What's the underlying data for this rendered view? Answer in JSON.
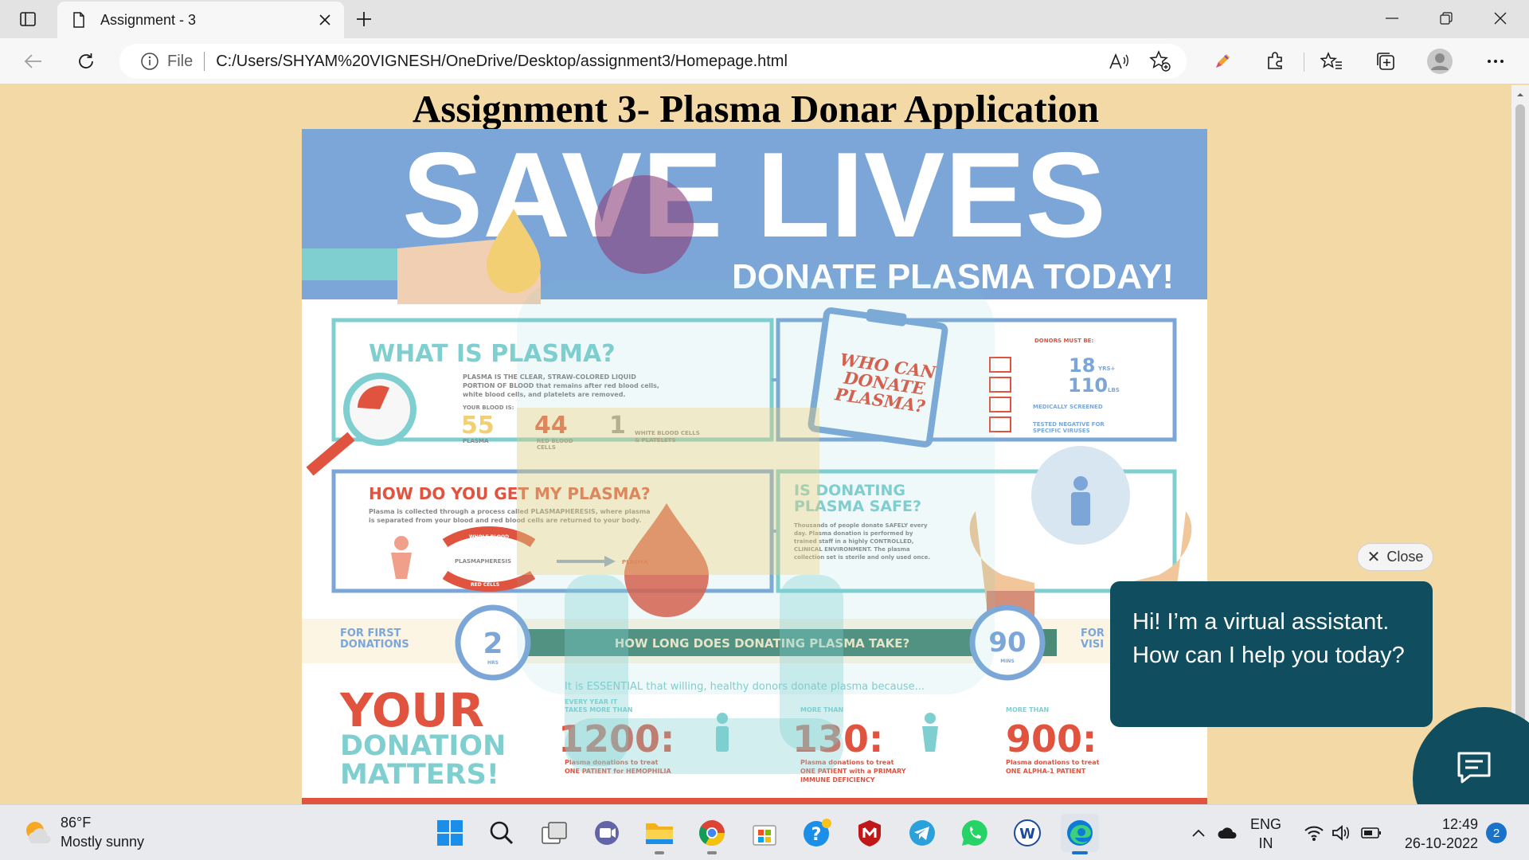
{
  "browser": {
    "tab_title": "Assignment - 3",
    "address_scheme": "File",
    "address_url": "C:/Users/SHYAM%20VIGNESH/OneDrive/Desktop/assignment3/Homepage.html"
  },
  "page": {
    "title": "Assignment 3- Plasma Donar Application"
  },
  "poster": {
    "headline": "SAVE LIVES",
    "subheadline": "DONATE PLASMA TODAY!",
    "what_title": "WHAT IS PLASMA?",
    "what_body_1": "PLASMA IS THE CLEAR, STRAW-COLORED LIQUID",
    "what_body_2": "PORTION OF BLOOD that remains after red blood cells,",
    "what_body_3": "white blood cells, and platelets are removed.",
    "your_blood": "YOUR BLOOD IS:",
    "stat_plasma_value": "55",
    "stat_plasma_label": "PLASMA",
    "stat_rbc_value": "44",
    "stat_rbc_label_1": "RED BLOOD",
    "stat_rbc_label_2": "CELLS",
    "stat_wbc_value": "1",
    "stat_wbc_label_1": "WHITE BLOOD CELLS",
    "stat_wbc_label_2": "& PLATELETS",
    "who_title_1": "WHO CAN",
    "who_title_2": "DONATE",
    "who_title_3": "PLASMA?",
    "donors_must_be": "DONORS MUST BE:",
    "req_age": "18",
    "req_age_unit": "YRS+",
    "req_weight": "110",
    "req_weight_unit": "LBS",
    "req_screened": "MEDICALLY SCREENED",
    "req_tested_1": "TESTED NEGATIVE FOR",
    "req_tested_2": "SPECIFIC VIRUSES",
    "how_title": "HOW DO YOU GET MY PLASMA?",
    "how_body_1": "Plasma is collected through a process called PLASMAPHERESIS, where plasma",
    "how_body_2": "is separated from your blood and red blood cells are returned to your body.",
    "how_blood_label": "WHOLE BLOOD",
    "how_process_label": "PLASMAPHERESIS",
    "how_cells_label": "RED CELLS",
    "how_plasma_label": "PLASMA",
    "safe_title_1": "IS DONATING",
    "safe_title_2": "PLASMA SAFE?",
    "safe_body_1": "Thousands of people donate SAFELY every",
    "safe_body_2": "day. Plasma donation is performed by",
    "safe_body_3": "trained staff in a highly CONTROLLED,",
    "safe_body_4": "CLINICAL ENVIRONMENT. The plasma",
    "safe_body_5": "collection set is sterile and only used once.",
    "time_first_1": "FOR FIRST",
    "time_first_2": "DONATIONS",
    "time_first_value": "2",
    "time_first_unit": "HRS",
    "time_question": "HOW LONG DOES DONATING PLASMA TAKE?",
    "time_repeat_value": "90",
    "time_repeat_unit": "MINS",
    "time_repeat_1": "FOR",
    "time_repeat_2": "VISI",
    "matters_1": "YOUR",
    "matters_2": "DONATION",
    "matters_3": "MATTERS!",
    "essential": "It is ESSENTIAL that willing, healthy donors donate plasma because...",
    "fact1_pre_1": "EVERY YEAR IT",
    "fact1_pre_2": "TAKES MORE THAN",
    "fact1_value": "1200:",
    "fact1_post_1": "Plasma donations to treat",
    "fact1_post_2": "ONE PATIENT for HEMOPHILIA",
    "fact2_pre": "MORE THAN",
    "fact2_value": "130:",
    "fact2_post_1": "Plasma donations to treat",
    "fact2_post_2": "ONE PATIENT with a PRIMARY",
    "fact2_post_3": "IMMUNE DEFICIENCY",
    "fact3_pre": "MORE THAN",
    "fact3_value": "900:",
    "fact3_post_1": "Plasma donations to treat",
    "fact3_post_2": "ONE ALPHA-1 PATIENT"
  },
  "chatbot": {
    "close_label": "Close",
    "message": "Hi! I’m a virtual assistant. How can I help you today?"
  },
  "taskbar": {
    "weather_temp": "86°F",
    "weather_desc": "Mostly sunny",
    "lang_1": "ENG",
    "lang_2": "IN",
    "time": "12:49",
    "date": "26-10-2022",
    "notification_count": "2"
  },
  "colors": {
    "page_bg": "#f3d9a6",
    "poster_blue": "#7ca6d8",
    "poster_teal": "#7fcfd0",
    "poster_red": "#e0533f",
    "poster_gold": "#f2cf73",
    "chat_bg": "#0f4d5f"
  },
  "icons": [
    "tab-actions-icon",
    "page-icon",
    "close-icon",
    "plus-icon",
    "minimize-icon",
    "restore-icon",
    "back-icon",
    "refresh-icon",
    "info-icon",
    "read-aloud-icon",
    "add-favorite-icon",
    "pen-icon",
    "extensions-icon",
    "favorites-icon",
    "collections-icon",
    "profile-icon",
    "more-icon",
    "chat-icon",
    "weather-icon",
    "windows-icon",
    "search-icon",
    "task-view-icon",
    "teams-icon",
    "file-explorer-icon",
    "chrome-icon",
    "store-icon",
    "help-icon",
    "mcafee-icon",
    "telegram-icon",
    "whatsapp-icon",
    "word-icon",
    "edge-icon",
    "chevron-up-icon",
    "cloud-icon",
    "wifi-icon",
    "volume-icon",
    "battery-icon"
  ]
}
